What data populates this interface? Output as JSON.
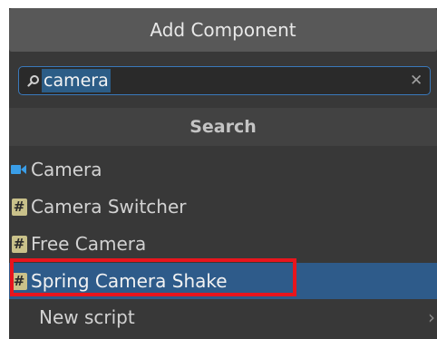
{
  "header": {
    "title": "Add Component"
  },
  "search": {
    "value": "camera",
    "clear_icon": "close-icon"
  },
  "section": {
    "label": "Search"
  },
  "items": [
    {
      "label": "Camera",
      "icon": "camera-icon"
    },
    {
      "label": "Camera Switcher",
      "icon": "script-icon"
    },
    {
      "label": "Free Camera",
      "icon": "script-icon"
    },
    {
      "label": "Spring Camera Shake",
      "icon": "script-icon",
      "selected": true,
      "highlighted": true
    }
  ],
  "new_script": {
    "label": "New script",
    "icon": "chevron-right-icon"
  },
  "colors": {
    "background": "#383838",
    "selection": "#2e5b8a",
    "search_border": "#3a79bb",
    "highlight_box": "#e8151d",
    "script_icon": "#c9c18a",
    "camera_icon": "#3a9ee8"
  }
}
